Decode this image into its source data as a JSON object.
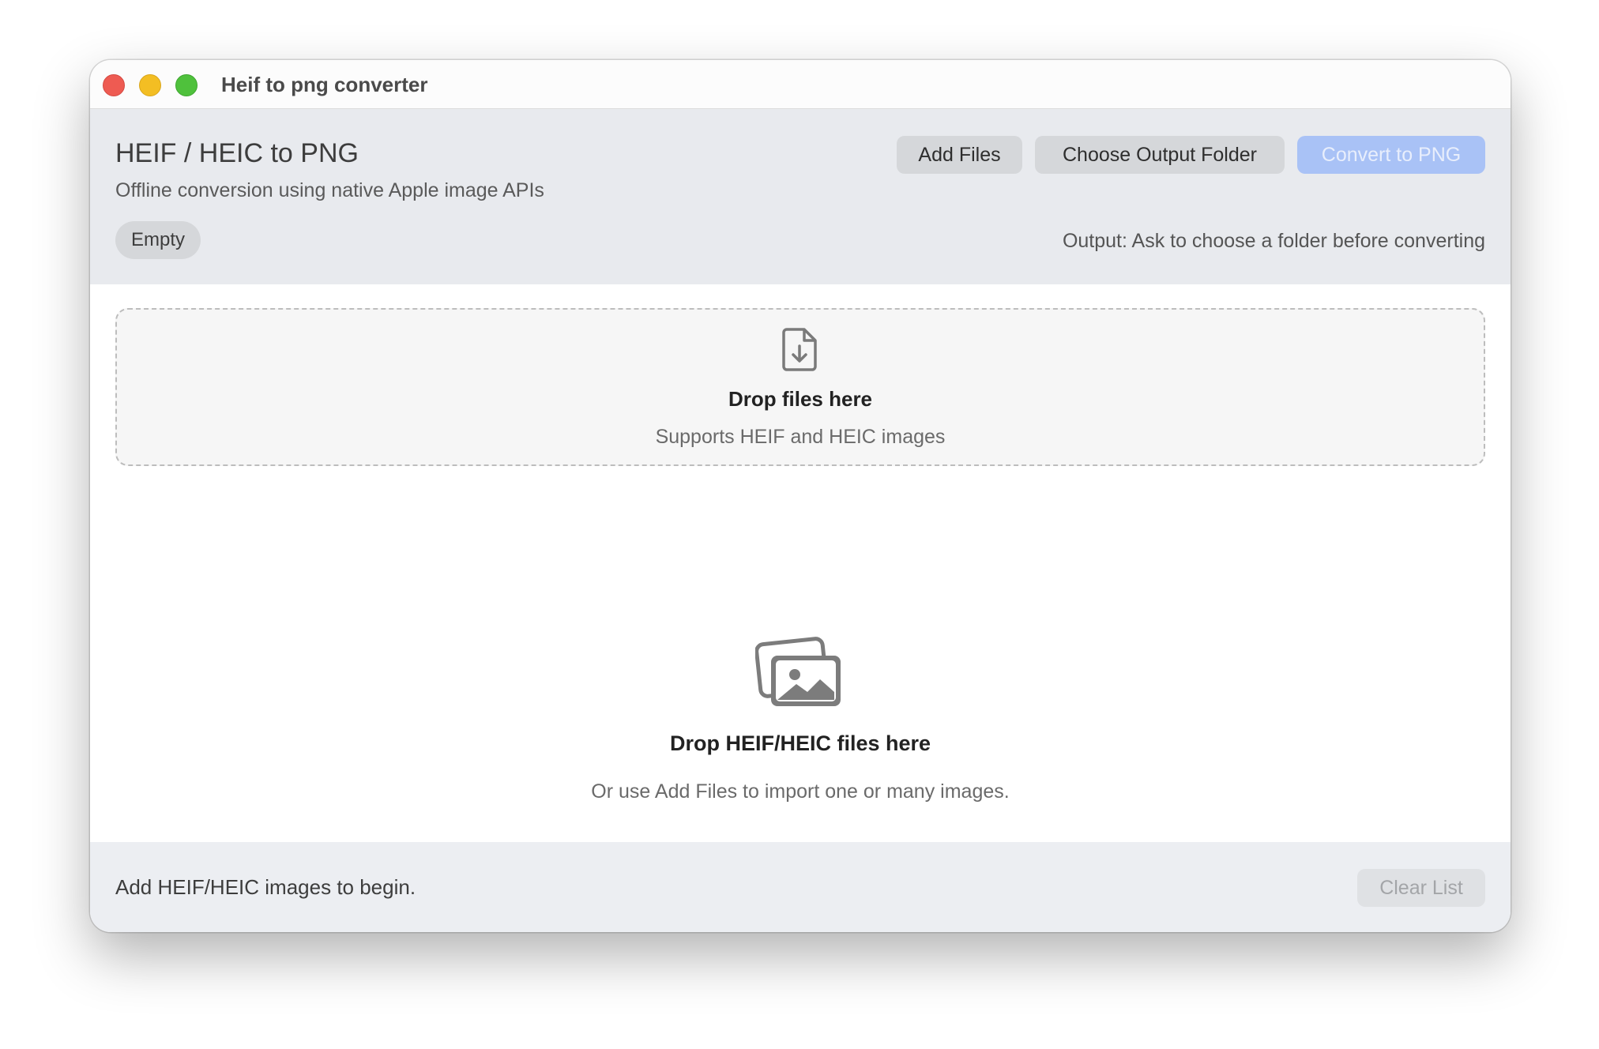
{
  "window": {
    "title": "Heif to png converter"
  },
  "header": {
    "title": "HEIF / HEIC to PNG",
    "subtitle": "Offline conversion using native Apple image APIs",
    "status_badge": "Empty",
    "output_label": "Output: Ask to choose a folder before converting",
    "buttons": {
      "add_files": "Add Files",
      "choose_output_folder": "Choose Output Folder",
      "convert": "Convert to PNG"
    },
    "convert_enabled": false
  },
  "dropzone": {
    "icon": "file-download-icon",
    "title": "Drop files here",
    "subtitle": "Supports HEIF and HEIC images"
  },
  "empty_state": {
    "icon": "photo-stack-icon",
    "title": "Drop HEIF/HEIC files here",
    "subtitle": "Or use Add Files to import one or many images."
  },
  "footer": {
    "status": "Add HEIF/HEIC images to begin.",
    "clear_label": "Clear List",
    "clear_enabled": false
  },
  "colors": {
    "traffic_close": "#ee5b52",
    "traffic_minimize": "#f3be23",
    "traffic_maximize": "#4fc13c",
    "accent_disabled": "#a9c2f6",
    "header_bg": "#e8eaee"
  }
}
